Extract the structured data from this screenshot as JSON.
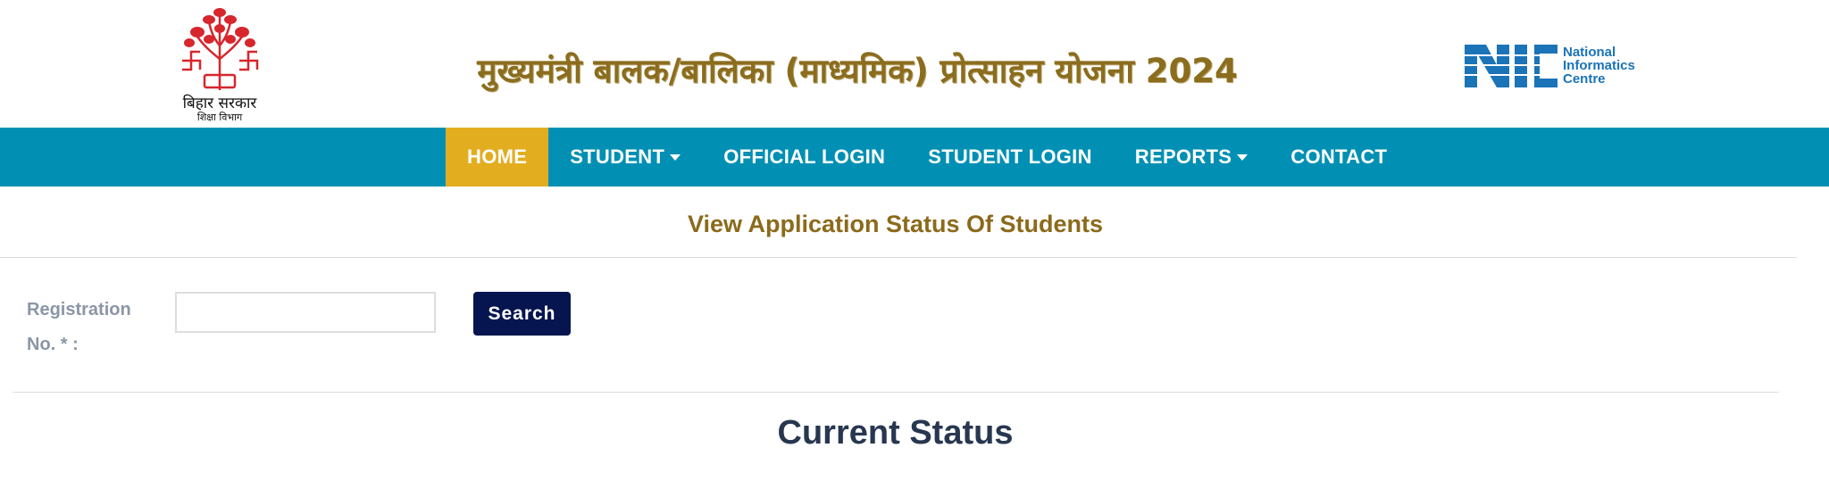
{
  "header": {
    "emblem": {
      "line1": "बिहार सरकार",
      "line2": "शिक्षा विभाग"
    },
    "title": "मुख्यमंत्री बालक/बालिका (माध्यमिक) प्रोत्साहन योजना 2024",
    "nic_logo": {
      "mark": "NIC",
      "line1": "National",
      "line2": "Informatics",
      "line3": "Centre"
    }
  },
  "nav": {
    "items": [
      {
        "label": "HOME",
        "active": true
      },
      {
        "label": "STUDENT",
        "dropdown": true
      },
      {
        "label": "OFFICIAL LOGIN"
      },
      {
        "label": "STUDENT LOGIN"
      },
      {
        "label": "REPORTS",
        "dropdown": true
      },
      {
        "label": "CONTACT"
      }
    ]
  },
  "main": {
    "heading": "View Application Status Of Students",
    "form": {
      "label": "Registration No. * :",
      "input_value": "",
      "input_placeholder": "",
      "search_label": "Search"
    },
    "status_heading": "Current Status"
  },
  "colors": {
    "nav_bg": "#0190b4",
    "nav_active": "#e3ad20",
    "title_gold": "#8b6d1e",
    "search_btn": "#06154f",
    "status_heading": "#283750",
    "emblem_red": "#d7262d",
    "nic_blue": "#1b73b8"
  }
}
